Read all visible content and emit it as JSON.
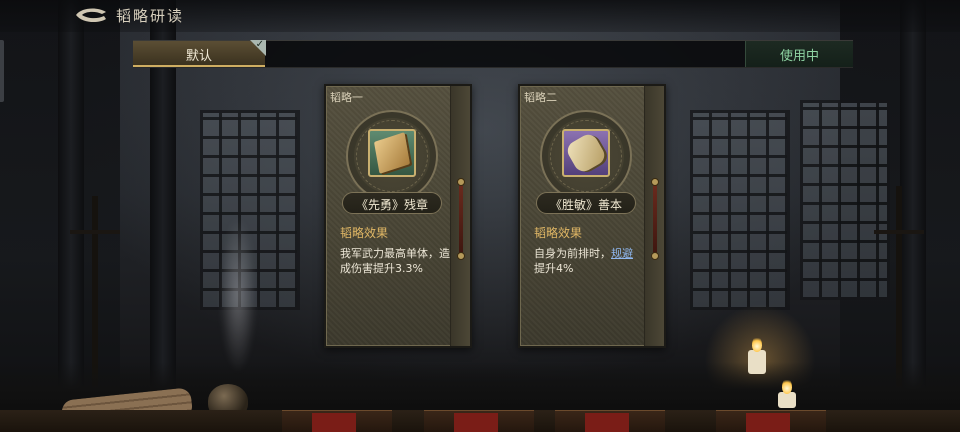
{
  "header": {
    "title": "韬略研读"
  },
  "scheme_bar": {
    "default_tab_label": "默认",
    "status_label": "使用中"
  },
  "cards": [
    {
      "tag": "韬略一",
      "item_name": "《先勇》残章",
      "effect_title": "韬略效果",
      "effect_text": "我军武力最高单体，造成伤害提升3.3%",
      "rarity_color": "#355742",
      "item_icon": "book-icon"
    },
    {
      "tag": "韬略二",
      "item_name": "《胜敏》善本",
      "effect_title": "韬略效果",
      "effect_text_before": "自身为前排时，",
      "effect_link": "规避",
      "effect_text_after": "提升4%",
      "rarity_color": "#53407b",
      "item_icon": "scroll-icon"
    }
  ],
  "colors": {
    "accent_gold": "#cfae62",
    "in_use_green": "#8fd4a3",
    "effect_title": "#e0b765",
    "link_blue": "#8fb7ee"
  }
}
